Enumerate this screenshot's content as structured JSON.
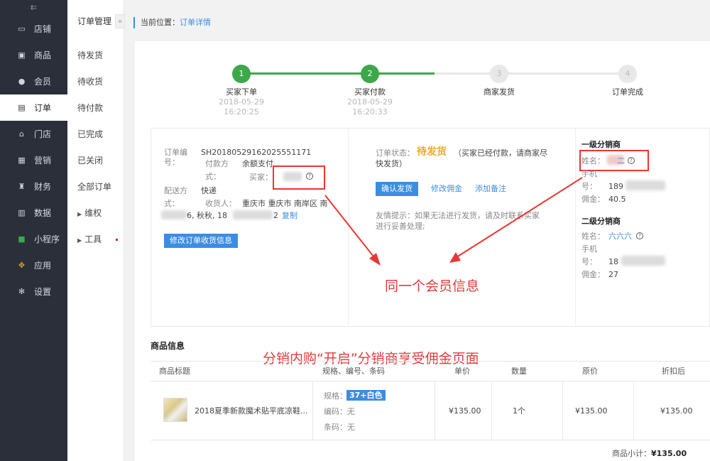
{
  "nav": {
    "toggle": "⇇",
    "items": [
      {
        "label": "店铺",
        "icon": "store-icon"
      },
      {
        "label": "商品",
        "icon": "goods-icon"
      },
      {
        "label": "会员",
        "icon": "member-icon"
      },
      {
        "label": "订单",
        "icon": "order-icon"
      },
      {
        "label": "门店",
        "icon": "shop-icon"
      },
      {
        "label": "营销",
        "icon": "marketing-icon"
      },
      {
        "label": "财务",
        "icon": "finance-icon"
      },
      {
        "label": "数据",
        "icon": "data-icon"
      },
      {
        "label": "小程序",
        "icon": "miniprogram-icon"
      },
      {
        "label": "应用",
        "icon": "apps-icon"
      },
      {
        "label": "设置",
        "icon": "settings-icon"
      }
    ]
  },
  "subnav": {
    "title": "订单管理",
    "collapse": "«",
    "items": [
      "待发货",
      "待收货",
      "待付款",
      "已完成",
      "已关闭",
      "全部订单"
    ],
    "groups": [
      "维权",
      "工具"
    ]
  },
  "breadcrumb": {
    "prefix": "当前位置：",
    "current": "订单详情"
  },
  "steps": [
    {
      "num": "1",
      "label": "买家下单",
      "date": "2018-05-29",
      "time": "16:20:25",
      "done": true
    },
    {
      "num": "2",
      "label": "买家付款",
      "date": "2018-05-29",
      "time": "16:20:33",
      "done": true
    },
    {
      "num": "3",
      "label": "商家发货",
      "date": "",
      "time": "",
      "done": false
    },
    {
      "num": "4",
      "label": "订单完成",
      "date": "",
      "time": "",
      "done": false
    }
  ],
  "order": {
    "no_label_1": "订单编",
    "no_label_2": "号：",
    "no": "SH20180529162025551171",
    "pay_label_1": "付款方",
    "pay_label_2": "式：",
    "pay": "余额支付",
    "buyer_label": "买家：",
    "ship_label_1": "配送方",
    "ship_label_2": "式：",
    "ship": "快递",
    "receiver_label": "收货人：",
    "address": "重庆市 重庆市 南岸区 南",
    "address2": "6, 秋秋, 18",
    "phone_tail": "2",
    "copy": "复制",
    "edit_btn": "修改订单收货信息"
  },
  "status": {
    "label": "订单状态：",
    "value": "待发货",
    "desc_1": "（买家已经付款，请商家尽",
    "desc_2": "快发货）",
    "confirm_btn": "确认发货",
    "edit_commission": "修改佣金",
    "add_note": "添加备注",
    "tip_1": "友情提示：如果无法进行发货，请及时联系买家",
    "tip_2": "进行妥善处理;"
  },
  "distributors": {
    "level1": {
      "title": "一级分销商",
      "name_label": "姓名：",
      "name": "二",
      "phone_label_1": "手机",
      "phone_label_2": "号：",
      "phone": "189",
      "commission_label": "佣金：",
      "commission": "40.5"
    },
    "level2": {
      "title": "二级分销商",
      "name_label": "姓名：",
      "name": "六六六",
      "phone_label_1": "手机",
      "phone_label_2": "号：",
      "phone": "18",
      "commission_label": "佣金：",
      "commission": "27"
    }
  },
  "annotations": {
    "same_member": "同一个会员信息",
    "page_note": "分销内购“开启”分销商享受佣金页面"
  },
  "goods": {
    "title": "商品信息",
    "headers": [
      "商品标题",
      "规格、编号、条码",
      "单价",
      "数量",
      "原价",
      "折扣后"
    ],
    "item": {
      "name": "2018夏季新款魔术贴平底凉鞋...",
      "spec_label": "规格：",
      "spec": "37+白色",
      "code_label": "编码：无",
      "barcode_label": "条码：无",
      "price": "¥135.00",
      "qty": "1个",
      "original": "¥135.00",
      "discounted": "¥135.00"
    },
    "subtotal_label": "商品小计：",
    "subtotal": "¥135.00"
  },
  "colors": {
    "nav_bg": "#2a2f3a",
    "accent": "#3c8de0",
    "success": "#3ca84a",
    "warning": "#f5a623",
    "annotation": "#e23a3a"
  }
}
